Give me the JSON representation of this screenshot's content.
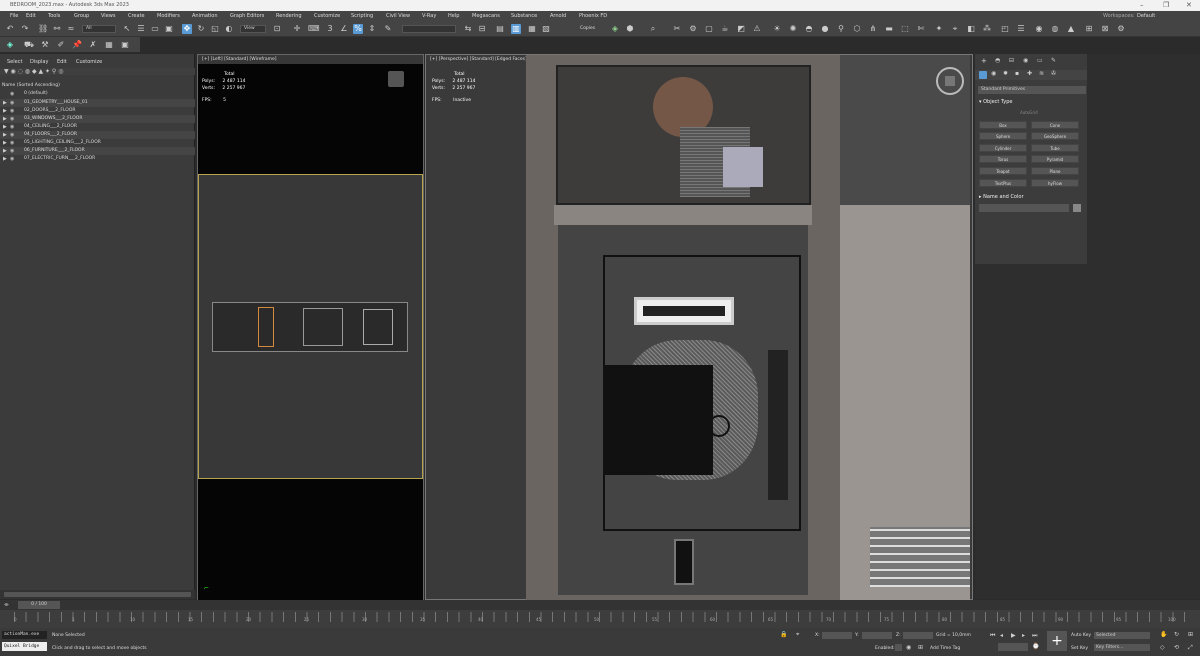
{
  "window": {
    "title": "BEDROOM_2023.max - Autodesk 3ds Max 2023"
  },
  "menu": [
    "File",
    "Edit",
    "Tools",
    "Group",
    "Views",
    "Create",
    "Modifiers",
    "Animation",
    "Graph Editors",
    "Rendering",
    "Customize",
    "Scripting",
    "Civil View",
    "V-Ray",
    "Help",
    "Megascans",
    "Substance",
    "Arnold",
    "Phoenix FD"
  ],
  "workspaces": {
    "label": "Workspaces:",
    "value": "Default"
  },
  "toolbar": {
    "selection_filter": "All",
    "ref_coord": "View",
    "copies_label": "Copies"
  },
  "scene_explorer": {
    "tabs": [
      "Select",
      "Display",
      "Edit",
      "Customize"
    ],
    "sort_label": "Name (Sorted Ascending)",
    "layers": [
      "0 (default)",
      "01_GEOMETRY___HOUSE_01",
      "02_DOORS___2_FLOOR",
      "03_WINDOWS___2_FLOOR",
      "04_CEILING___2_FLOOR",
      "04_FLOORS___2_FLOOR",
      "05_LIGHTING_CEILING___2_FLOOR",
      "06_FURNITURE___2_FLOOR",
      "07_ELECTRIC_FURN___2_FLOOR"
    ]
  },
  "viewport_left": {
    "label": "[+] [Left] [Standard] [Wireframe]",
    "total": "Total",
    "polys": "Polys:",
    "polys_val": "2 487 114",
    "verts": "Verts:",
    "verts_val": "2 257 967",
    "fps": "FPS:",
    "fps_val": "5"
  },
  "viewport_persp": {
    "label": "[+] [Perspective] [Standard] [Edged Faces]",
    "total": "Total",
    "polys": "Polys:",
    "polys_val": "2 487 114",
    "verts": "Verts:",
    "verts_val": "2 257 967",
    "fps": "FPS:",
    "fps_val": "Inactive"
  },
  "command_panel": {
    "dropdown": "Standard Primitives",
    "object_type": "Object Type",
    "autogrid": "AutoGrid",
    "buttons": [
      "Box",
      "Cone",
      "Sphere",
      "GeoSphere",
      "Cylinder",
      "Tube",
      "Torus",
      "Pyramid",
      "Teapot",
      "Plane",
      "TextPlus",
      "hyFlow"
    ],
    "name_color": "Name and Color"
  },
  "timeline": {
    "frame": "0 / 100",
    "ticks": [
      "0",
      "5",
      "10",
      "15",
      "20",
      "25",
      "30",
      "35",
      "40",
      "45",
      "50",
      "55",
      "60",
      "65",
      "70",
      "75",
      "80",
      "85",
      "90",
      "95",
      "100"
    ]
  },
  "status": {
    "maxscript": "actionMan.exe",
    "quixel": "Quixel Bridge",
    "none_selected": "None Selected",
    "prompt": "Click and drag to select and move objects",
    "x": "X:",
    "y": "Y:",
    "z": "Z:",
    "grid": "Grid = 10,0mm",
    "enabled": "Enabled:",
    "add_time_tag": "Add Time Tag",
    "auto_key": "Auto Key",
    "selected": "Selected",
    "set_key": "Set Key",
    "key_filters": "Key Filters..."
  }
}
